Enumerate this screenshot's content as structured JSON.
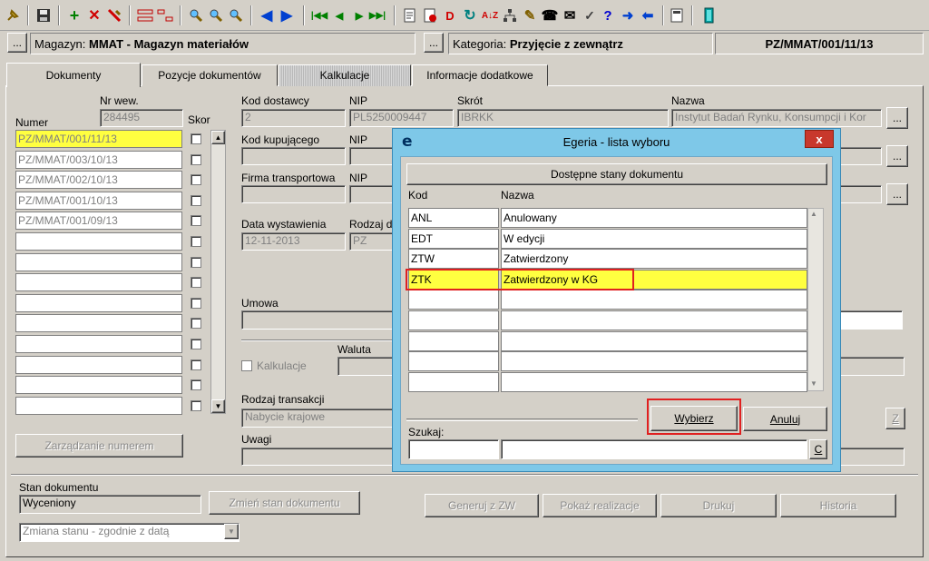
{
  "toolbar": {
    "icons": [
      "pin-icon",
      "save-icon",
      "add-icon",
      "delete-icon",
      "edit-icon",
      "split-icon",
      "split-alt-icon",
      "search-icon",
      "search-next-icon",
      "search-help-icon",
      "arrow-left-icon",
      "arrow-right-icon",
      "first-record-icon",
      "prev-record-icon",
      "next-record-icon",
      "last-record-icon",
      "report-icon",
      "filter-icon",
      "filter-d-icon",
      "refresh-icon",
      "sort-icon",
      "tree-icon",
      "brush-icon",
      "phone-icon",
      "mail-icon",
      "check-icon",
      "help-icon",
      "forward-icon",
      "back-icon",
      "calc-icon",
      "exit-door-icon"
    ],
    "help_glyph": "?"
  },
  "header": {
    "magazyn_label": "Magazyn:",
    "magazyn_value": "MMAT - Magazyn materiałów",
    "kategoria_label": "Kategoria:",
    "kategoria_value": "Przyjęcie z zewnątrz",
    "doc_number": "PZ/MMAT/001/11/13",
    "browse_label": "..."
  },
  "tabs": [
    "Dokumenty",
    "Pozycje dokumentów",
    "Kalkulacje",
    "Informacje dodatkowe"
  ],
  "left": {
    "nr_wew_label": "Nr wew.",
    "nr_wew_value": "284495",
    "numer_label": "Numer",
    "skor_label": "Skor",
    "numbers": [
      "PZ/MMAT/001/11/13",
      "PZ/MMAT/003/10/13",
      "PZ/MMAT/002/10/13",
      "PZ/MMAT/001/10/13",
      "PZ/MMAT/001/09/13",
      "",
      "",
      "",
      "",
      "",
      "",
      "",
      "",
      ""
    ],
    "zarzadzanie_button": "Zarządzanie numerem",
    "stan_label": "Stan dokumentu",
    "stan_value": "Wyceniony",
    "zmien_stan_button": "Zmień stan dokumentu",
    "zmiana_select": "Zmiana stanu - zgodnie z datą"
  },
  "main": {
    "kod_dostawcy_label": "Kod dostawcy",
    "kod_dostawcy_value": "2",
    "nip_label": "NIP",
    "nip_value": "PL5250009447",
    "skrot_label": "Skrót",
    "skrot_value": "IBRKK",
    "nazwa_label": "Nazwa",
    "nazwa_value": "Instytut Badań Rynku, Konsumpcji i Kor",
    "kod_kupujacego_label": "Kod kupującego",
    "firma_transportowa_label": "Firma transportowa",
    "data_wystawienia_label": "Data wystawienia",
    "data_wystawienia_value": "12-11-2013",
    "rodzaj_label": "Rodzaj d",
    "rodzaj_value": "PZ",
    "umowa_label": "Umowa",
    "waluta_label": "Waluta",
    "kalkulacje_checkbox": "Kalkulacje",
    "rodzaj_transakcji_label": "Rodzaj transakcji",
    "rodzaj_transakcji_value": "Nabycie krajowe",
    "uwagi_label": "Uwagi",
    "z_button": "Z",
    "generuj_button": "Generuj z ZW",
    "pokaz_button": "Pokaż realizacje",
    "drukuj_button": "Drukuj",
    "historia_button": "Historia"
  },
  "dialog": {
    "app_glyph": "e",
    "title": "Egeria - lista wyboru",
    "close_glyph": "x",
    "section_button": "Dostępne stany dokumentu",
    "col_kod": "Kod",
    "col_nazwa": "Nazwa",
    "rows": [
      {
        "kod": "ANL",
        "nazwa": "Anulowany"
      },
      {
        "kod": "EDT",
        "nazwa": "W edycji"
      },
      {
        "kod": "ZTW",
        "nazwa": "Zatwierdzony"
      },
      {
        "kod": "ZTK",
        "nazwa": "Zatwierdzony w KG"
      },
      {
        "kod": "",
        "nazwa": ""
      },
      {
        "kod": "",
        "nazwa": ""
      },
      {
        "kod": "",
        "nazwa": ""
      },
      {
        "kod": "",
        "nazwa": ""
      },
      {
        "kod": "",
        "nazwa": ""
      }
    ],
    "selected_index": 3,
    "wybierz_button": "Wybierz",
    "anuluj_button": "Anuluj",
    "szukaj_label": "Szukaj:",
    "clear_button": "C",
    "highlight_color": "#e02020"
  }
}
